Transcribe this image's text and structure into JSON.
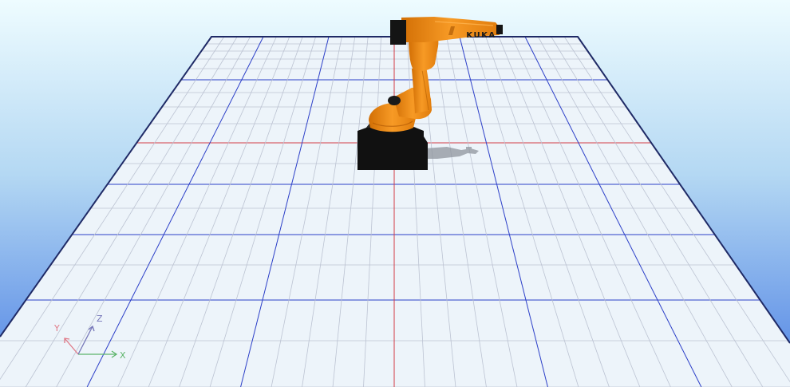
{
  "viewport": {
    "sky_top_color": "#eefcff",
    "sky_bottom_color": "#4f82e4",
    "floor_color": "#edf4fa",
    "floor_edge_color": "#1f2a66"
  },
  "grid": {
    "major_line_color": "#2c3fc8",
    "minor_line_color": "#bcc3d2",
    "axis_line_color": "#d33c46"
  },
  "robot": {
    "brand_label": "KUKA",
    "body_color": "#f08a12",
    "base_color": "#111111"
  },
  "axes_gizmo": {
    "x_label": "X",
    "y_label": "Y",
    "z_label": "Z",
    "x_color": "#5db46a",
    "y_color": "#e07a88",
    "z_color": "#7576b8"
  }
}
